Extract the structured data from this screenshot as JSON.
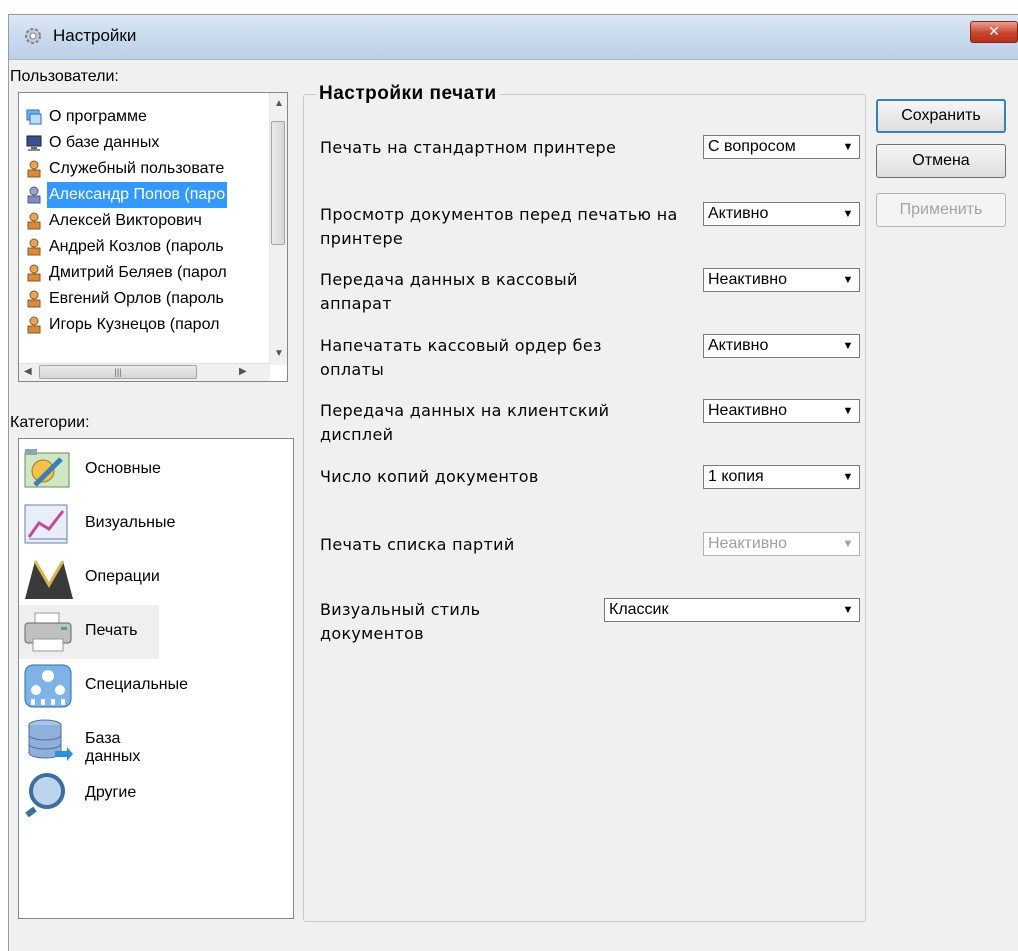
{
  "window": {
    "title": "Настройки",
    "close_glyph": "✕"
  },
  "users": {
    "label": "Пользователи:",
    "items": [
      {
        "label": "О программе",
        "icon": "windows-icon"
      },
      {
        "label": "О базе данных",
        "icon": "computer-icon"
      },
      {
        "label": "Служебный пользовате",
        "icon": "user-icon"
      },
      {
        "label": "Александр Попов (паро",
        "icon": "user-icon",
        "selected": true
      },
      {
        "label": "Алексей Викторович",
        "icon": "user-icon"
      },
      {
        "label": "Андрей Козлов (пароль",
        "icon": "user-icon"
      },
      {
        "label": "Дмитрий Беляев (парол",
        "icon": "user-icon"
      },
      {
        "label": "Евгений Орлов (пароль",
        "icon": "user-icon"
      },
      {
        "label": "Игорь Кузнецов (парол",
        "icon": "user-icon"
      }
    ]
  },
  "categories": {
    "label": "Категории:",
    "items": [
      {
        "label": "Основные",
        "icon": "general-settings-icon"
      },
      {
        "label": "Визуальные",
        "icon": "visual-chart-icon"
      },
      {
        "label": "Операции",
        "icon": "operations-icon"
      },
      {
        "label": "Печать",
        "icon": "printer-icon",
        "selected": true
      },
      {
        "label": "Специальные",
        "icon": "special-controls-icon"
      },
      {
        "label": "База данных",
        "icon": "database-icon"
      },
      {
        "label": "Другие",
        "icon": "magnifier-icon"
      }
    ]
  },
  "print_settings": {
    "title": "Настройки печати",
    "rows": [
      {
        "label": "Печать на стандартном принтере",
        "value": "С вопросом"
      },
      {
        "label": "Просмотр документов перед печатью на принтере",
        "value": "Активно"
      },
      {
        "label": "Передача данных в кассовый аппарат",
        "value": "Неактивно"
      },
      {
        "label": "Напечатать кассовый ордер без оплаты",
        "value": "Активно"
      },
      {
        "label": "Передача данных на клиентский дисплей",
        "value": "Неактивно"
      },
      {
        "label": "Число копий документов",
        "value": "1 копия"
      },
      {
        "label": "Печать списка партий",
        "value": "Неактивно",
        "disabled": true
      },
      {
        "label": "Визуальный стиль документов",
        "value": "Классик"
      }
    ]
  },
  "buttons": {
    "save": "Сохранить",
    "cancel": "Отмена",
    "apply": "Применить"
  },
  "colors": {
    "selection": "#3399ff",
    "title_gradient": "#c9daee",
    "close": "#c8452c"
  }
}
